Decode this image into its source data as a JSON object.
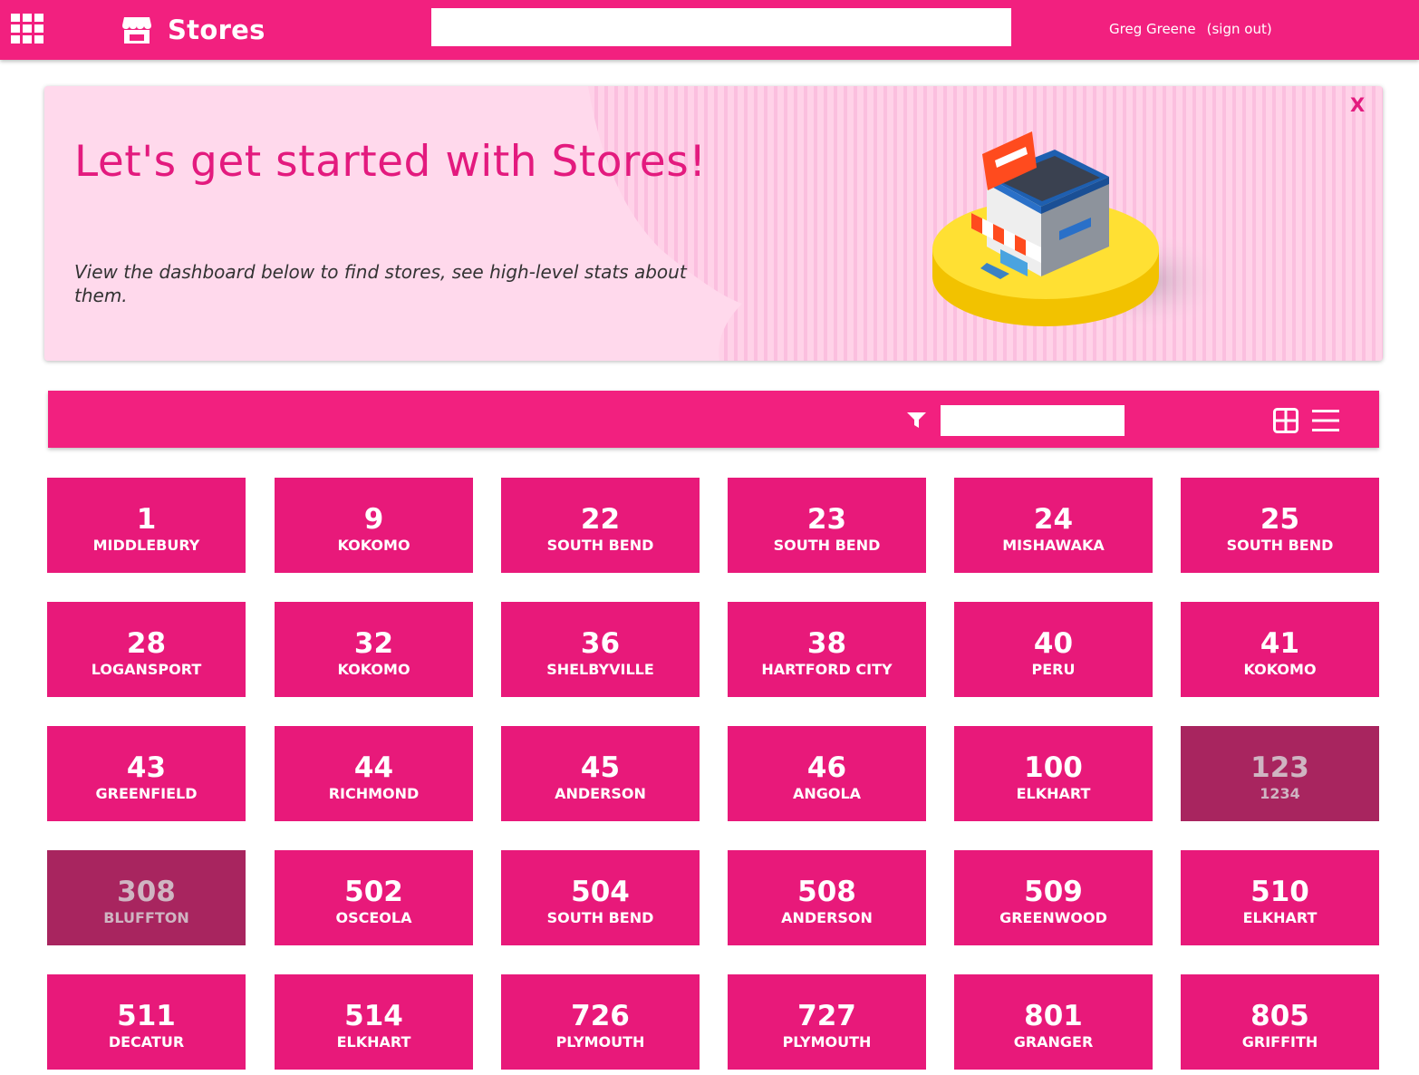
{
  "header": {
    "title": "Stores",
    "search_value": "",
    "user_name": "Greg Greene",
    "sign_out_label": "(sign out)",
    "brand_color": "#f2207f",
    "icons": {
      "apps": "apps-grid-icon",
      "brand": "storefront-icon"
    }
  },
  "banner": {
    "title": "Let's get started with Stores!",
    "description": "View the dashboard below to find stores, see high-level stats about them.",
    "close_label": "X",
    "illustration": "store-building-illustration"
  },
  "toolbar": {
    "filter_value": "",
    "icons": {
      "filter": "filter-funnel-icon",
      "grid_view": "grid-view-icon",
      "list_view": "list-view-icon"
    }
  },
  "colors": {
    "tile_active": "#e8197a",
    "tile_inactive": "#a8255f",
    "banner_bg": "#ffd9ec",
    "accent_text": "#e31a7e"
  },
  "stores": [
    {
      "number": "1",
      "city": "MIDDLEBURY",
      "active": true
    },
    {
      "number": "9",
      "city": "KOKOMO",
      "active": true
    },
    {
      "number": "22",
      "city": "SOUTH BEND",
      "active": true
    },
    {
      "number": "23",
      "city": "SOUTH BEND",
      "active": true
    },
    {
      "number": "24",
      "city": "MISHAWAKA",
      "active": true
    },
    {
      "number": "25",
      "city": "SOUTH BEND",
      "active": true
    },
    {
      "number": "28",
      "city": "LOGANSPORT",
      "active": true
    },
    {
      "number": "32",
      "city": "KOKOMO",
      "active": true
    },
    {
      "number": "36",
      "city": "SHELBYVILLE",
      "active": true
    },
    {
      "number": "38",
      "city": "HARTFORD CITY",
      "active": true
    },
    {
      "number": "40",
      "city": "PERU",
      "active": true
    },
    {
      "number": "41",
      "city": "KOKOMO",
      "active": true
    },
    {
      "number": "43",
      "city": "GREENFIELD",
      "active": true
    },
    {
      "number": "44",
      "city": "RICHMOND",
      "active": true
    },
    {
      "number": "45",
      "city": "ANDERSON",
      "active": true
    },
    {
      "number": "46",
      "city": "ANGOLA",
      "active": true
    },
    {
      "number": "100",
      "city": "ELKHART",
      "active": true
    },
    {
      "number": "123",
      "city": "1234",
      "active": false
    },
    {
      "number": "308",
      "city": "BLUFFTON",
      "active": false
    },
    {
      "number": "502",
      "city": "OSCEOLA",
      "active": true
    },
    {
      "number": "504",
      "city": "SOUTH BEND",
      "active": true
    },
    {
      "number": "508",
      "city": "ANDERSON",
      "active": true
    },
    {
      "number": "509",
      "city": "GREENWOOD",
      "active": true
    },
    {
      "number": "510",
      "city": "ELKHART",
      "active": true
    },
    {
      "number": "511",
      "city": "DECATUR",
      "active": true
    },
    {
      "number": "514",
      "city": "ELKHART",
      "active": true
    },
    {
      "number": "726",
      "city": "PLYMOUTH",
      "active": true
    },
    {
      "number": "727",
      "city": "PLYMOUTH",
      "active": true
    },
    {
      "number": "801",
      "city": "GRANGER",
      "active": true
    },
    {
      "number": "805",
      "city": "GRIFFITH",
      "active": true
    }
  ]
}
